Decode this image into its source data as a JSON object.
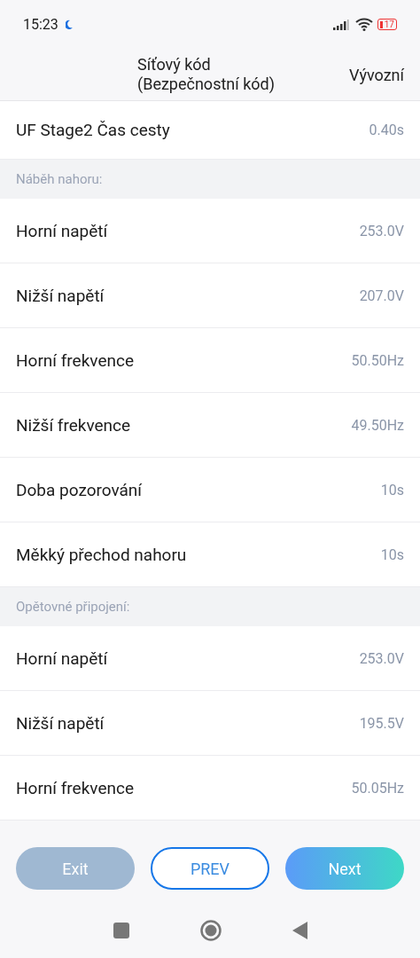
{
  "status_bar": {
    "time": "15:23",
    "battery": "17"
  },
  "header": {
    "title_line1": "Síťový kód",
    "title_line2": "(Bezpečnostní kód)",
    "action": "Vývozní"
  },
  "items": [
    {
      "kind": "row",
      "label": "UF Stage2 Čas cesty",
      "value": "0.40s"
    },
    {
      "kind": "section",
      "label": "Náběh nahoru:"
    },
    {
      "kind": "row",
      "label": "Horní napětí",
      "value": "253.0V"
    },
    {
      "kind": "row",
      "label": "Nižší napětí",
      "value": "207.0V"
    },
    {
      "kind": "row",
      "label": "Horní frekvence",
      "value": "50.50Hz"
    },
    {
      "kind": "row",
      "label": "Nižší frekvence",
      "value": "49.50Hz"
    },
    {
      "kind": "row",
      "label": "Doba pozorování",
      "value": "10s"
    },
    {
      "kind": "row",
      "label": "Měkký přechod nahoru",
      "value": "10s"
    },
    {
      "kind": "section",
      "label": "Opětovné připojení:"
    },
    {
      "kind": "row",
      "label": "Horní napětí",
      "value": "253.0V"
    },
    {
      "kind": "row",
      "label": "Nižší napětí",
      "value": "195.5V"
    },
    {
      "kind": "row",
      "label": "Horní frekvence",
      "value": "50.05Hz"
    }
  ],
  "buttons": [
    {
      "kind": "filled",
      "label": "Exit",
      "disabled": true
    },
    {
      "kind": "outline",
      "label": "PREV",
      "disabled": false
    },
    {
      "kind": "gradient",
      "label": "Next",
      "disabled": false
    }
  ]
}
